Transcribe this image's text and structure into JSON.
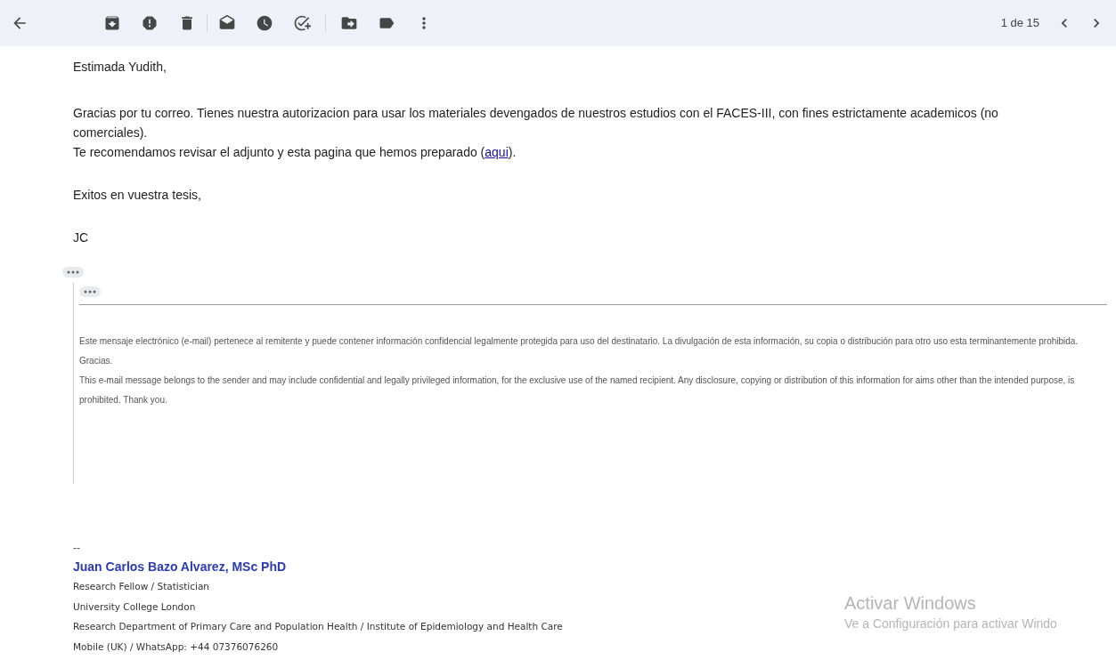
{
  "toolbar": {
    "pager": "1 de 15"
  },
  "message": {
    "greeting": "Estimada Yudith,",
    "paragraphs": [
      {
        "before": "Gracias por tu correo. Tienes nuestra autorizacion para usar los materiales devengados de nuestros estudios con el FACES-III, con fines estrictamente academicos (no comerciales)."
      },
      {
        "before": "Te recomendamos revisar el adjunto y esta pagina que hemos preparado (",
        "link": "aqui",
        "after": ")."
      }
    ],
    "closing": "Exitos en vuestra tesis,",
    "signoff": "JC",
    "disclaimer": [
      "Este mensaje electrónico (e-mail) pertenece al remitente y puede contener  información confidencial legalmente protegida para uso del destinatario. La divulgación de esta información, su copia o distribución para otro uso esta terminantemente prohibida.",
      "Gracias.",
      "This e-mail message belongs to the sender and may include confidential and legally privileged information, for the exclusive use of the named recipient. Any disclosure, copying or distribution of this information for aims other than the intended purpose, is prohibited. Thank you."
    ]
  },
  "signature": {
    "separator": "--",
    "name": "Juan Carlos Bazo Alvarez, MSc PhD",
    "lines": [
      "Research Fellow / Statistician",
      "University College London",
      "Research Department of Primary Care and Population Health / Institute of Epidemiology and Health Care",
      "Mobile (UK) / WhatsApp: +44 07376076260"
    ]
  },
  "overlay": {
    "title": "Activar Windows",
    "subtitle": "Ve a Configuración para activar Windo"
  }
}
